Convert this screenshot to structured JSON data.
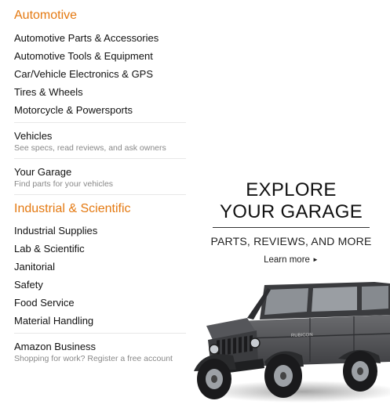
{
  "automotive": {
    "title": "Automotive",
    "links": [
      "Automotive Parts & Accessories",
      "Automotive Tools & Equipment",
      "Car/Vehicle Electronics & GPS",
      "Tires & Wheels",
      "Motorcycle & Powersports"
    ],
    "vehicles": {
      "title": "Vehicles",
      "desc": "See specs, read reviews, and ask owners"
    },
    "garage": {
      "title": "Your Garage",
      "desc": "Find parts for your vehicles"
    }
  },
  "industrial": {
    "title": "Industrial & Scientific",
    "links": [
      "Industrial Supplies",
      "Lab & Scientific",
      "Janitorial",
      "Safety",
      "Food Service",
      "Material Handling"
    ],
    "business": {
      "title": "Amazon Business",
      "desc": "Shopping for work? Register a free account"
    }
  },
  "promo": {
    "line1": "EXPLORE",
    "line2": "YOUR GARAGE",
    "subtitle": "PARTS, REVIEWS, AND MORE",
    "cta": "Learn more",
    "cta_icon": "caret-right-icon",
    "image": "jeep-wrangler-image",
    "badge_text": "RUBICON"
  },
  "colors": {
    "accent": "#e47911",
    "text": "#111111",
    "muted": "#888888",
    "divider": "#e7e7e7"
  }
}
